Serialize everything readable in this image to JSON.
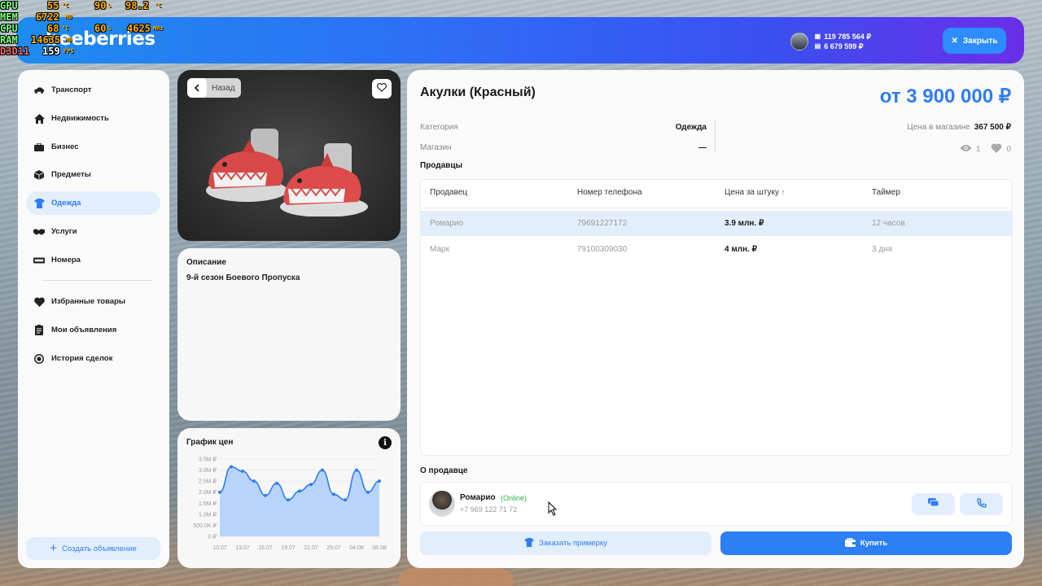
{
  "hud": {
    "rows": [
      {
        "label": "GPU",
        "v1": "55",
        "u1": "°C",
        "v2": "90",
        "u2": "%",
        "v3": "98.2",
        "u3": "°C"
      },
      {
        "label": "MEM",
        "v1": "6722",
        "u1": "MB"
      },
      {
        "label": "CPU",
        "v1": "68",
        "u1": "°C",
        "v2": "60",
        "u2": "%",
        "v3": "4625",
        "u3": "MHz"
      },
      {
        "label": "RAM",
        "v1": "14635",
        "u1": "MB"
      },
      {
        "label": "D3D11",
        "v1": "159",
        "u1": "FPS"
      }
    ]
  },
  "header": {
    "logo": "beeberries",
    "balance_cash": "119 785 564 ₽",
    "balance_bank": "6 679 599 ₽",
    "close_label": "Закрыть",
    "brand_colors": [
      "#1e8cf0",
      "#3a4ff0",
      "#6a2ee8"
    ]
  },
  "sidebar": {
    "items": [
      {
        "label": "Транспорт",
        "icon": "car-icon"
      },
      {
        "label": "Недвижимость",
        "icon": "house-icon"
      },
      {
        "label": "Бизнес",
        "icon": "briefcase-icon"
      },
      {
        "label": "Предметы",
        "icon": "box-icon"
      },
      {
        "label": "Одежда",
        "icon": "tshirt-icon",
        "active": true
      },
      {
        "label": "Услуги",
        "icon": "handshake-icon"
      },
      {
        "label": "Номера",
        "icon": "license-plate-icon"
      }
    ],
    "secondary": [
      {
        "label": "Избранные товары",
        "icon": "heart-icon"
      },
      {
        "label": "Мои объявления",
        "icon": "clipboard-icon"
      },
      {
        "label": "История сделок",
        "icon": "history-icon"
      }
    ],
    "create_label": "Создать объявление"
  },
  "image_card": {
    "back_label": "Назад"
  },
  "description": {
    "title": "Описание",
    "text": "9-й сезон Боевого Пропуска"
  },
  "price_chart": {
    "title": "График цен",
    "info_icon_text": "i"
  },
  "chart_data": {
    "type": "area",
    "title": "График цен",
    "xlabel": "",
    "ylabel": "",
    "ylim": [
      0,
      3500000
    ],
    "y_ticks": [
      "0 ₽",
      "500.0K ₽",
      "1.0M ₽",
      "1.5M ₽",
      "2.0M ₽",
      "2.5M ₽",
      "3.0M ₽",
      "3.5M ₽"
    ],
    "x_ticks": [
      "10.07",
      "13.07",
      "16.07",
      "19.07",
      "22.07",
      "29.07",
      "04.08",
      "06.08"
    ],
    "values": [
      2000000,
      3150000,
      2950000,
      2500000,
      1850000,
      2400000,
      1650000,
      2050000,
      2350000,
      3000000,
      1900000,
      1650000,
      3000000,
      2000000,
      2500000
    ],
    "grid": true,
    "color": "#2e7cf6"
  },
  "main": {
    "title": "Акулки (Красный)",
    "price": "от 3 900 000 ₽",
    "category_key": "Категория",
    "category_val": "Одежда",
    "shop_key": "Магазин",
    "shop_val": "—",
    "shop_price_key": "Цена в магазине",
    "shop_price_val": "367 500 ₽",
    "views": "1",
    "likes": "0",
    "sellers_label": "Продавцы",
    "table": {
      "headers": [
        "Продавец",
        "Номер телефона",
        "Цена за штуку",
        "Таймер"
      ],
      "sort_marker": "↑",
      "rows": [
        {
          "seller": "Ромарио",
          "phone": "79691227172",
          "price": "3.9 млн. ₽",
          "timer": "12 часов",
          "highlight": true
        },
        {
          "seller": "Марк",
          "phone": "79100309030",
          "price": "4 млн. ₽",
          "timer": "3 дня",
          "highlight": false
        }
      ]
    },
    "about_label": "О продавце",
    "seller": {
      "name": "Ромарио",
      "status": "(Online)",
      "phone": "+7 969 122 71 72"
    },
    "try_label": "Заказать примерку",
    "buy_label": "Купить"
  }
}
